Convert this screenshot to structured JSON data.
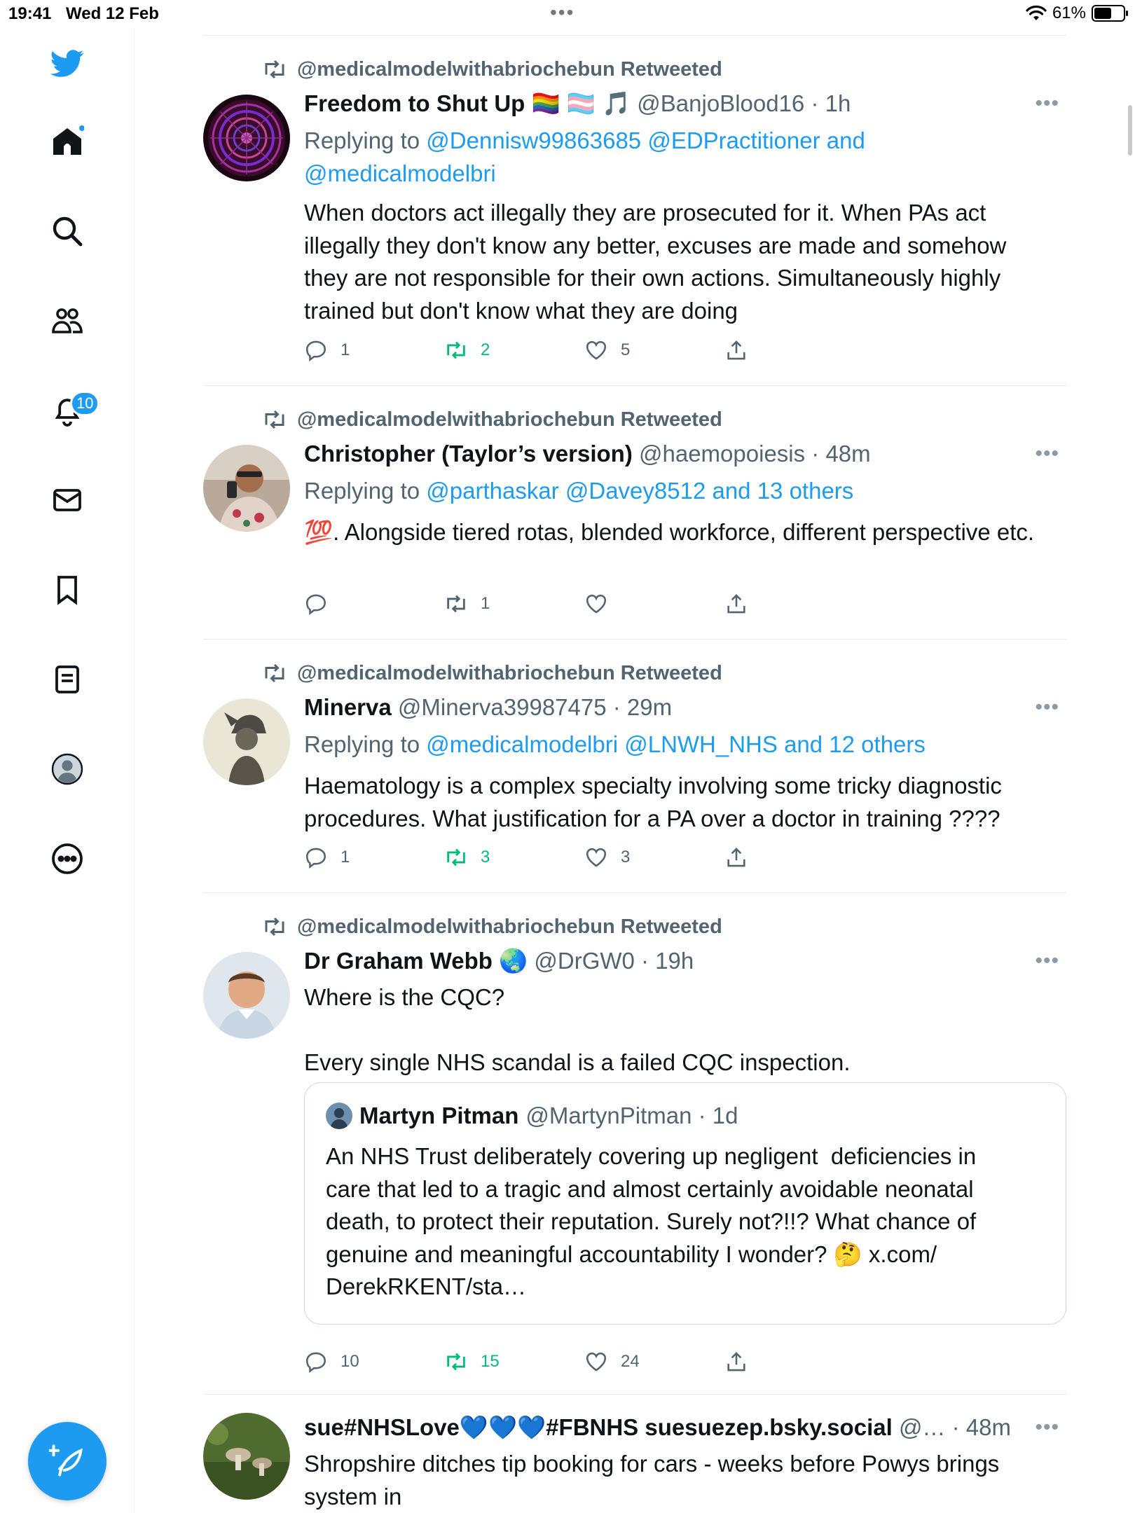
{
  "status_bar": {
    "time": "19:41",
    "date": "Wed 12 Feb",
    "battery_percent": "61%",
    "battery_level": 0.61
  },
  "sidebar": {
    "items": [
      {
        "name": "twitter-bird-icon"
      },
      {
        "name": "home-icon",
        "has_dot": true
      },
      {
        "name": "search-icon"
      },
      {
        "name": "communities-icon"
      },
      {
        "name": "notifications-icon",
        "badge": "10"
      },
      {
        "name": "messages-icon"
      },
      {
        "name": "bookmarks-icon"
      },
      {
        "name": "lists-icon"
      },
      {
        "name": "profile-icon"
      },
      {
        "name": "more-icon"
      }
    ],
    "compose_icon": "compose-feather-icon"
  },
  "colors": {
    "accent": "#1d9bf0",
    "retweet_active": "#00ba7c",
    "secondary_text": "#536471"
  },
  "tweets": [
    {
      "retweeted_by": "@medicalmodelwithabriochebun Retweeted",
      "name": "Freedom to Shut Up",
      "name_emoji": "🏳️‍🌈 🏳️‍⚧️ 🎵",
      "handle_time": "@BanjoBlood16 · 1h",
      "replying_prefix": "Replying to",
      "replying_to": "@Dennisw99863685 @EDPractitioner and @medicalmodelbri",
      "text": "When doctors act illegally they are prosecuted for it. When PAs act illegally they don't know any better, excuses are made and somehow they are not responsible for their own actions. Simultaneously highly trained but don't know what they are doing",
      "replies": "1",
      "retweets": "2",
      "likes": "5",
      "retweeted": true
    },
    {
      "retweeted_by": "@medicalmodelwithabriochebun Retweeted",
      "name": "Christopher (Taylor’s version)",
      "handle_time": "@haemopoiesis · 48m",
      "replying_prefix": "Replying to",
      "replying_to": "@parthaskar @Davey8512 and 13 others",
      "text": "💯. Alongside tiered rotas, blended workforce, different perspective etc.",
      "replies": "",
      "retweets": "1",
      "likes": "",
      "retweeted": false
    },
    {
      "retweeted_by": "@medicalmodelwithabriochebun Retweeted",
      "name": "Minerva",
      "handle_time": "@Minerva39987475 · 29m",
      "replying_prefix": "Replying to",
      "replying_to": "@medicalmodelbri @LNWH_NHS and 12 others",
      "text": "Haematology is a complex specialty involving some tricky diagnostic procedures. What justification for a PA over a doctor in training ????",
      "replies": "1",
      "retweets": "3",
      "likes": "3",
      "retweeted": true
    },
    {
      "retweeted_by": "@medicalmodelwithabriochebun Retweeted",
      "name": "Dr Graham Webb",
      "name_emoji": "🌏",
      "handle_time": "@DrGW0 · 19h",
      "text": "Where is the CQC?\n\nEvery single NHS scandal is a failed CQC inspection.",
      "quote": {
        "name": "Martyn Pitman",
        "handle_time": "@MartynPitman · 1d",
        "text": "An NHS Trust deliberately covering up negligent  deficiencies in care that led to a tragic and almost certainly avoidable neonatal death, to protect their reputation. Surely not?!!? What chance of genuine and meaningful accountability I wonder? 🤔 x.com/\nDerekRKENT/sta…"
      },
      "replies": "10",
      "retweets": "15",
      "likes": "24",
      "retweeted": true
    },
    {
      "name": "sue#NHSLove💙💙💙#FBNHS suesuezep.bsky.social",
      "handle_time": "@… · 48m",
      "text": "Shropshire ditches tip booking for cars - weeks before Powys brings system in"
    }
  ]
}
